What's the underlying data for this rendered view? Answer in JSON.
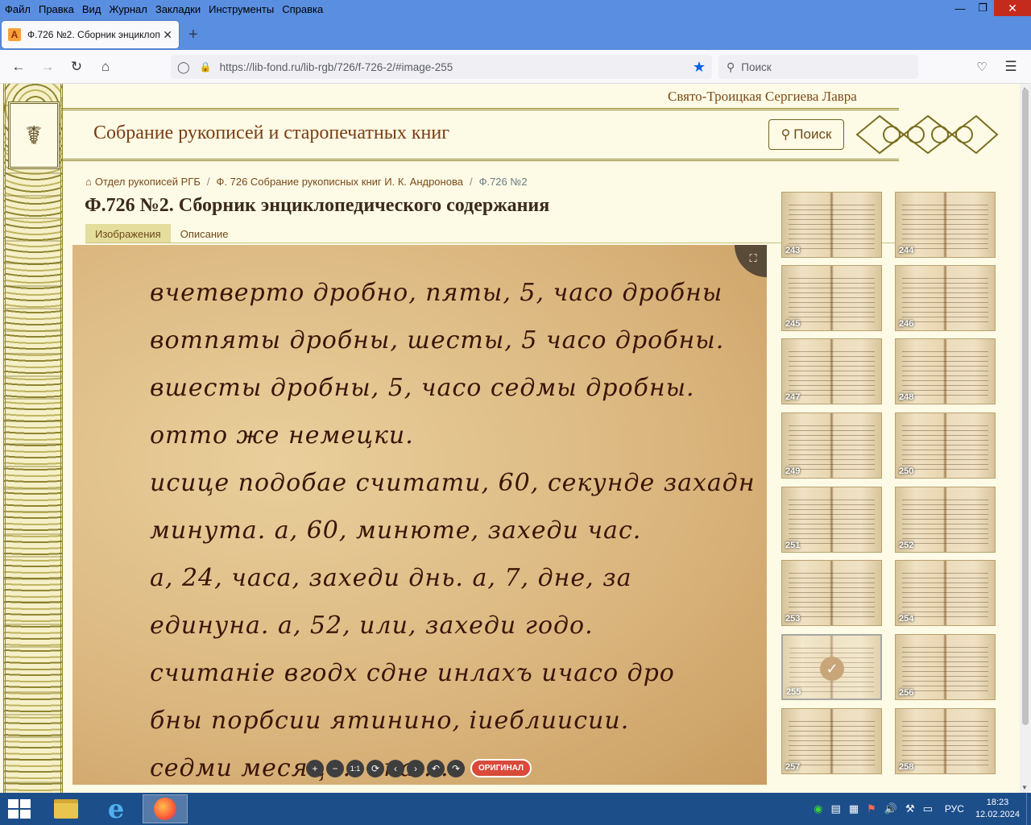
{
  "browser": {
    "menu": [
      "Файл",
      "Правка",
      "Вид",
      "Журнал",
      "Закладки",
      "Инструменты",
      "Справка"
    ],
    "window_controls": [
      "minimize-icon",
      "restore-icon",
      "close-icon"
    ],
    "tab": {
      "title": "Ф.726 №2. Сборник энциклопе",
      "close_glyph": "✕",
      "favicon_letter": "A"
    },
    "new_tab_glyph": "+",
    "url": "https://lib-fond.ru/lib-rgb/726/f-726-2/#image-255",
    "search_placeholder": "Поиск"
  },
  "site": {
    "brand": "Свято-Троицкая Сергиева Лавра",
    "title": "Собрание рукописей и старопечатных книг",
    "search_button": "Поиск"
  },
  "breadcrumb": {
    "items": [
      "Отдел рукописей РГБ",
      "Ф. 726 Собрание рукописных книг И. К. Андронова",
      "Ф.726 №2"
    ],
    "separator": "/"
  },
  "document": {
    "title": "Ф.726 №2. Сборник энциклопедического содержания",
    "tabs": [
      {
        "label": "Изображения",
        "active": true
      },
      {
        "label": "Описание",
        "active": false
      }
    ]
  },
  "viewer": {
    "manuscript_lines": [
      "вчетверто дробно, пяты, 5, часо дробны",
      "вотпяты дробны, шесты, 5 часо дробны.",
      "вшесты дробны, 5, часо седмы дробны.",
      "отто же немецки.",
      "исице подобае считати, 60, секунде захадн",
      "минута. а, 60, минюте, захеди час.",
      "а, 24, часа, захеди днь. а, 7, дне, за",
      "единуна. а, 52, или, захеди годо.",
      "считаніе вгодх сдне инлахъ ичасо дро",
      "бны порбсии ятинино, іиеблиисии.",
      "седми месяц ... опа ..."
    ],
    "controls": [
      "+",
      "−",
      "1:1",
      "⟳",
      "‹",
      "›",
      "↶",
      "↷"
    ],
    "original_button": "ОРИГИНАЛ"
  },
  "thumbnails": [
    {
      "num": "243"
    },
    {
      "num": "244"
    },
    {
      "num": "245"
    },
    {
      "num": "246"
    },
    {
      "num": "247"
    },
    {
      "num": "248"
    },
    {
      "num": "249"
    },
    {
      "num": "250"
    },
    {
      "num": "251"
    },
    {
      "num": "252"
    },
    {
      "num": "253"
    },
    {
      "num": "254"
    },
    {
      "num": "255",
      "selected": true
    },
    {
      "num": "256"
    },
    {
      "num": "257"
    },
    {
      "num": "258"
    }
  ],
  "taskbar": {
    "language": "РУС",
    "time": "18:23",
    "date": "12.02.2024"
  }
}
